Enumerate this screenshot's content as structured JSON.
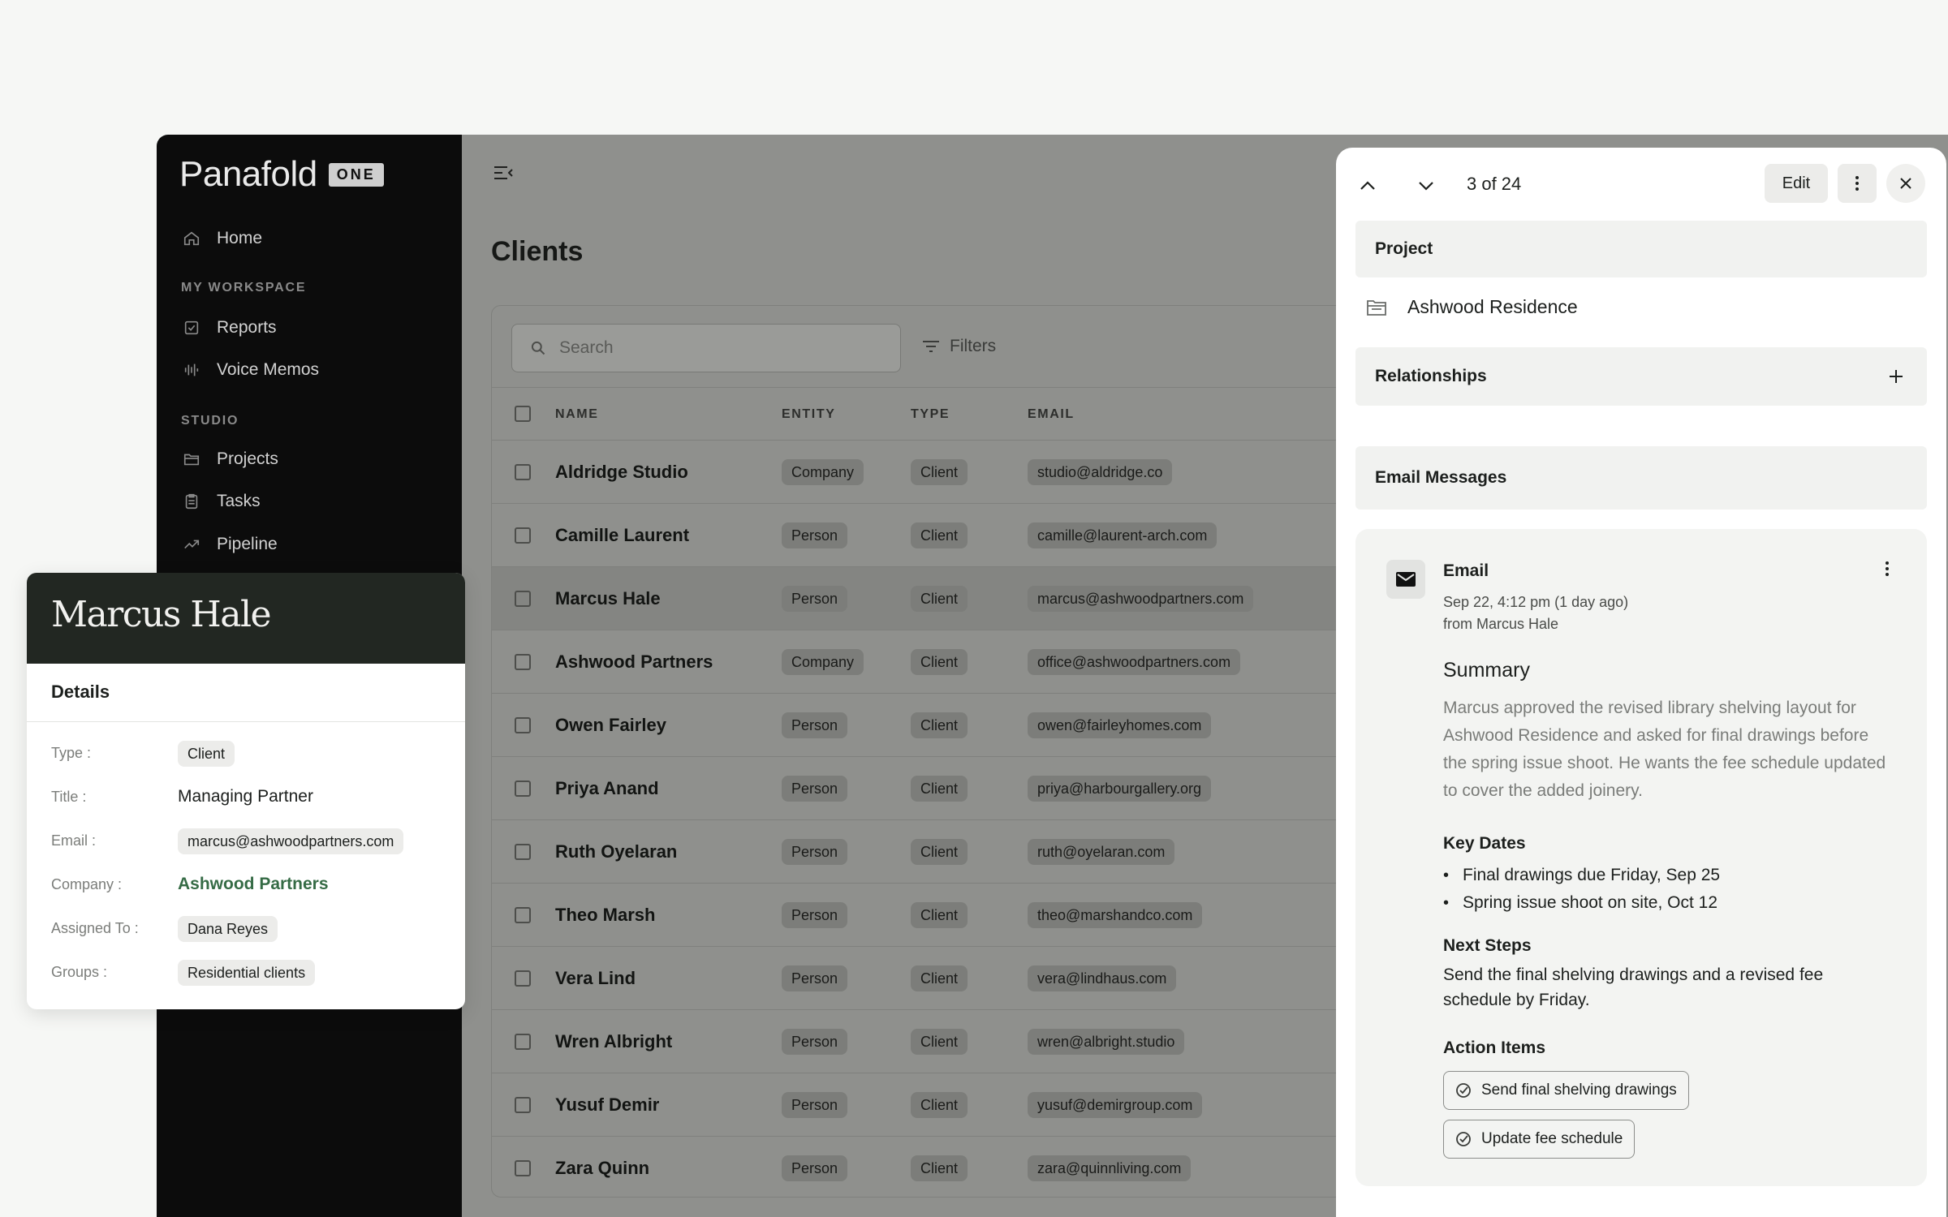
{
  "app": {
    "brand": "Panafold",
    "brand_badge": "ONE"
  },
  "sidebar": {
    "home": "Home",
    "section_workspace": "MY WORKSPACE",
    "reports": "Reports",
    "voice_memos": "Voice Memos",
    "section_studio": "STUDIO",
    "projects": "Projects",
    "tasks": "Tasks",
    "pipeline": "Pipeline"
  },
  "main": {
    "title": "Clients",
    "search_placeholder": "Search",
    "filters_label": "Filters",
    "columns": [
      "NAME",
      "ENTITY",
      "TYPE",
      "EMAIL"
    ],
    "rows": [
      {
        "name": "Aldridge Studio",
        "entity": "Company",
        "type": "Client",
        "email": "studio@aldridge.co"
      },
      {
        "name": "Camille Laurent",
        "entity": "Person",
        "type": "Client",
        "email": "camille@laurent-arch.com"
      },
      {
        "name": "Marcus Hale",
        "entity": "Person",
        "type": "Client",
        "email": "marcus@ashwoodpartners.com"
      },
      {
        "name": "Ashwood Partners",
        "entity": "Company",
        "type": "Client",
        "email": "office@ashwoodpartners.com"
      },
      {
        "name": "Owen Fairley",
        "entity": "Person",
        "type": "Client",
        "email": "owen@fairleyhomes.com"
      },
      {
        "name": "Priya Anand",
        "entity": "Person",
        "type": "Client",
        "email": "priya@harbourgallery.org"
      },
      {
        "name": "Ruth Oyelaran",
        "entity": "Person",
        "type": "Client",
        "email": "ruth@oyelaran.com"
      },
      {
        "name": "Theo Marsh",
        "entity": "Person",
        "type": "Client",
        "email": "theo@marshandco.com"
      },
      {
        "name": "Vera Lind",
        "entity": "Person",
        "type": "Client",
        "email": "vera@lindhaus.com"
      },
      {
        "name": "Wren Albright",
        "entity": "Person",
        "type": "Client",
        "email": "wren@albright.studio"
      },
      {
        "name": "Yusuf Demir",
        "entity": "Person",
        "type": "Client",
        "email": "yusuf@demirgroup.com"
      },
      {
        "name": "Zara Quinn",
        "entity": "Person",
        "type": "Client",
        "email": "zara@quinnliving.com"
      }
    ],
    "selected_row": 2
  },
  "panel": {
    "counter": "3 of 24",
    "edit_label": "Edit",
    "project_heading": "Project",
    "project_name": "Ashwood Residence",
    "relationships_heading": "Relationships",
    "email_messages_heading": "Email Messages",
    "email": {
      "title": "Email",
      "date": "Sep 22, 4:12 pm (1 day ago)",
      "from": "from Marcus Hale",
      "summary_heading": "Summary",
      "summary": "Marcus approved the revised library shelving layout for Ashwood Residence and asked for final drawings before the spring issue shoot. He wants the fee schedule updated to cover the added joinery.",
      "key_dates_heading": "Key Dates",
      "key_dates": [
        "Final drawings due Friday, Sep 25",
        "Spring issue shoot on site, Oct 12"
      ],
      "next_steps_heading": "Next Steps",
      "next_steps": "Send the final shelving drawings and a revised fee schedule by Friday.",
      "action_items_heading": "Action Items",
      "action_items": [
        "Send final shelving drawings",
        "Update fee schedule"
      ]
    }
  },
  "contact_card": {
    "name": "Marcus Hale",
    "details_label": "Details",
    "fields": {
      "type_label": "Type :",
      "type_value": "Client",
      "title_label": "Title :",
      "title_value": "Managing Partner",
      "email_label": "Email :",
      "email_value": "marcus@ashwoodpartners.com",
      "company_label": "Company :",
      "company_value": "Ashwood Partners",
      "assigned_label": "Assigned To :",
      "assigned_value": "Dana Reyes",
      "groups_label": "Groups :",
      "groups_value": "Residential clients"
    }
  },
  "colors": {
    "sidebar_bg": "#0c0c0c",
    "main_overlay": "#8f908d",
    "company_link": "#356b45",
    "contact_header": "#222722"
  }
}
